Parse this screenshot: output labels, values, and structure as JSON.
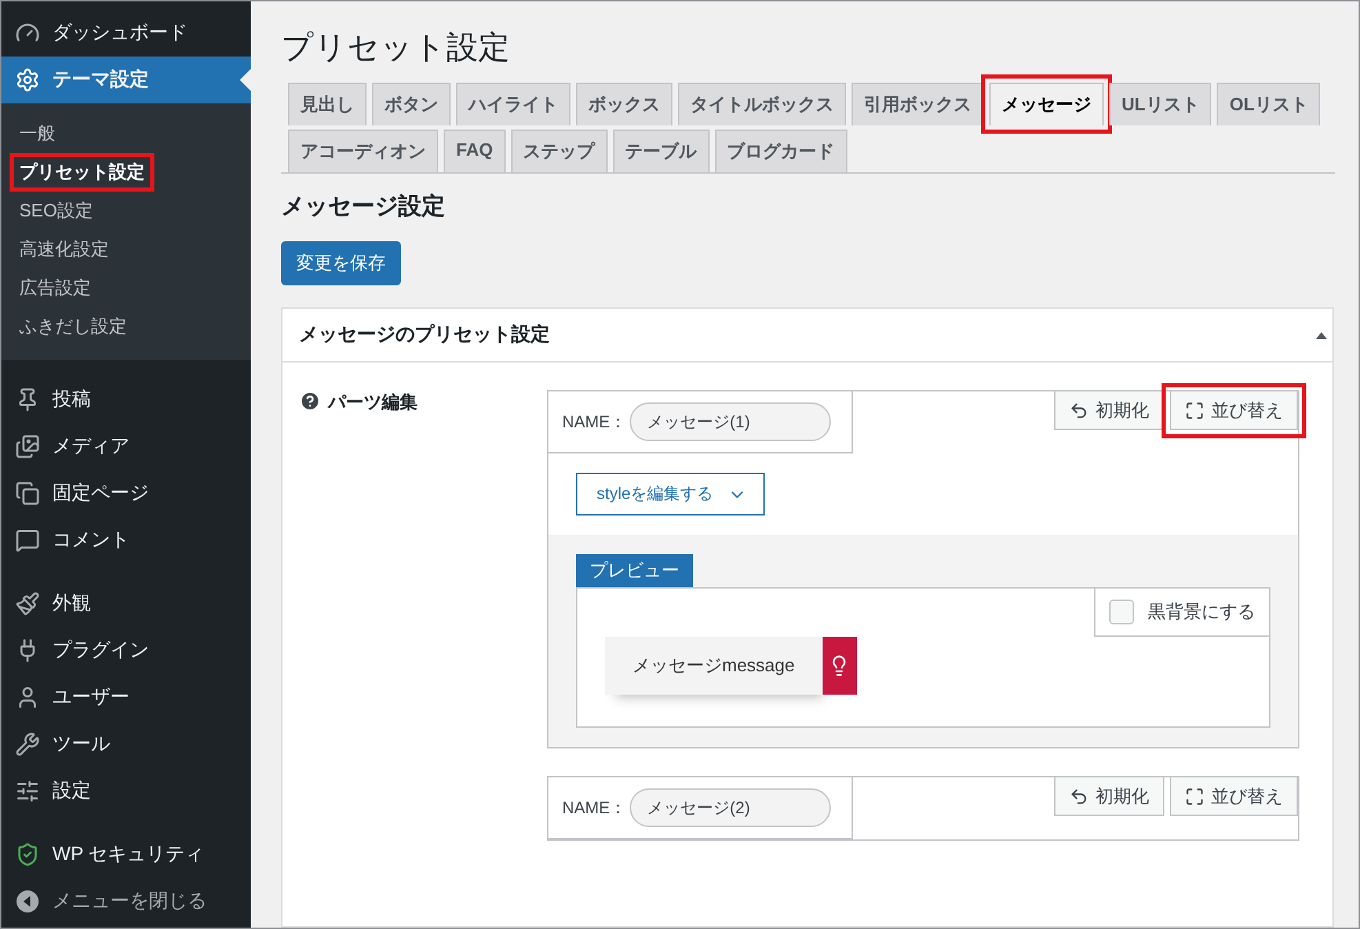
{
  "sidebar": {
    "groups": [
      [
        {
          "label": "ダッシュボード",
          "selected": false
        },
        {
          "label": "テーマ設定",
          "selected": true,
          "children": [
            {
              "label": "一般",
              "selected": false,
              "highlighted": false
            },
            {
              "label": "プリセット設定",
              "selected": true,
              "highlighted": true
            },
            {
              "label": "SEO設定",
              "selected": false,
              "highlighted": false
            },
            {
              "label": "高速化設定",
              "selected": false,
              "highlighted": false
            },
            {
              "label": "広告設定",
              "selected": false,
              "highlighted": false
            },
            {
              "label": "ふきだし設定",
              "selected": false,
              "highlighted": false
            }
          ]
        }
      ],
      [
        {
          "label": "投稿",
          "selected": false
        },
        {
          "label": "メディア",
          "selected": false
        },
        {
          "label": "固定ページ",
          "selected": false
        },
        {
          "label": "コメント",
          "selected": false
        }
      ],
      [
        {
          "label": "外観",
          "selected": false
        },
        {
          "label": "プラグイン",
          "selected": false
        },
        {
          "label": "ユーザー",
          "selected": false
        },
        {
          "label": "ツール",
          "selected": false
        },
        {
          "label": "設定",
          "selected": false
        }
      ],
      [
        {
          "label": "WP セキュリティ",
          "selected": false
        },
        {
          "label": "メニューを閉じる",
          "selected": false,
          "kind": "collapse"
        }
      ]
    ]
  },
  "page_title": "プリセット設定",
  "tabs": [
    {
      "label": "見出し",
      "selected": false,
      "highlighted": false
    },
    {
      "label": "ボタン",
      "selected": false,
      "highlighted": false
    },
    {
      "label": "ハイライト",
      "selected": false,
      "highlighted": false
    },
    {
      "label": "ボックス",
      "selected": false,
      "highlighted": false
    },
    {
      "label": "タイトルボックス",
      "selected": false,
      "highlighted": false
    },
    {
      "label": "引用ボックス",
      "selected": false,
      "highlighted": false
    },
    {
      "label": "メッセージ",
      "selected": true,
      "highlighted": true
    },
    {
      "label": "ULリスト",
      "selected": false,
      "highlighted": false
    },
    {
      "label": "OLリスト",
      "selected": false,
      "highlighted": false
    },
    {
      "label": "アコーディオン",
      "selected": false,
      "highlighted": false
    },
    {
      "label": "FAQ",
      "selected": false,
      "highlighted": false
    },
    {
      "label": "ステップ",
      "selected": false,
      "highlighted": false
    },
    {
      "label": "テーブル",
      "selected": false,
      "highlighted": false
    },
    {
      "label": "ブログカード",
      "selected": false,
      "highlighted": false
    }
  ],
  "section_title": "メッセージ設定",
  "save_button": "変更を保存",
  "card": {
    "title": "メッセージのプリセット設定",
    "expanded": true,
    "field_label": "パーツ編集",
    "parts": [
      {
        "name_label": "NAME：",
        "name": "メッセージ(1)",
        "buttons": [
          {
            "label": "初期化",
            "kind": "reset",
            "highlighted": false
          },
          {
            "label": "並び替え",
            "kind": "sort",
            "highlighted": true
          }
        ],
        "style_button": "styleを編集する",
        "preview": {
          "label": "プレビュー",
          "dark_checkbox": {
            "label": "黒背景にする",
            "checked": false
          },
          "message": "メッセージmessage"
        }
      },
      {
        "name_label": "NAME：",
        "name": "メッセージ(2)",
        "buttons": [
          {
            "label": "初期化",
            "kind": "reset",
            "highlighted": false
          },
          {
            "label": "並び替え",
            "kind": "sort",
            "highlighted": false
          }
        ]
      }
    ]
  }
}
